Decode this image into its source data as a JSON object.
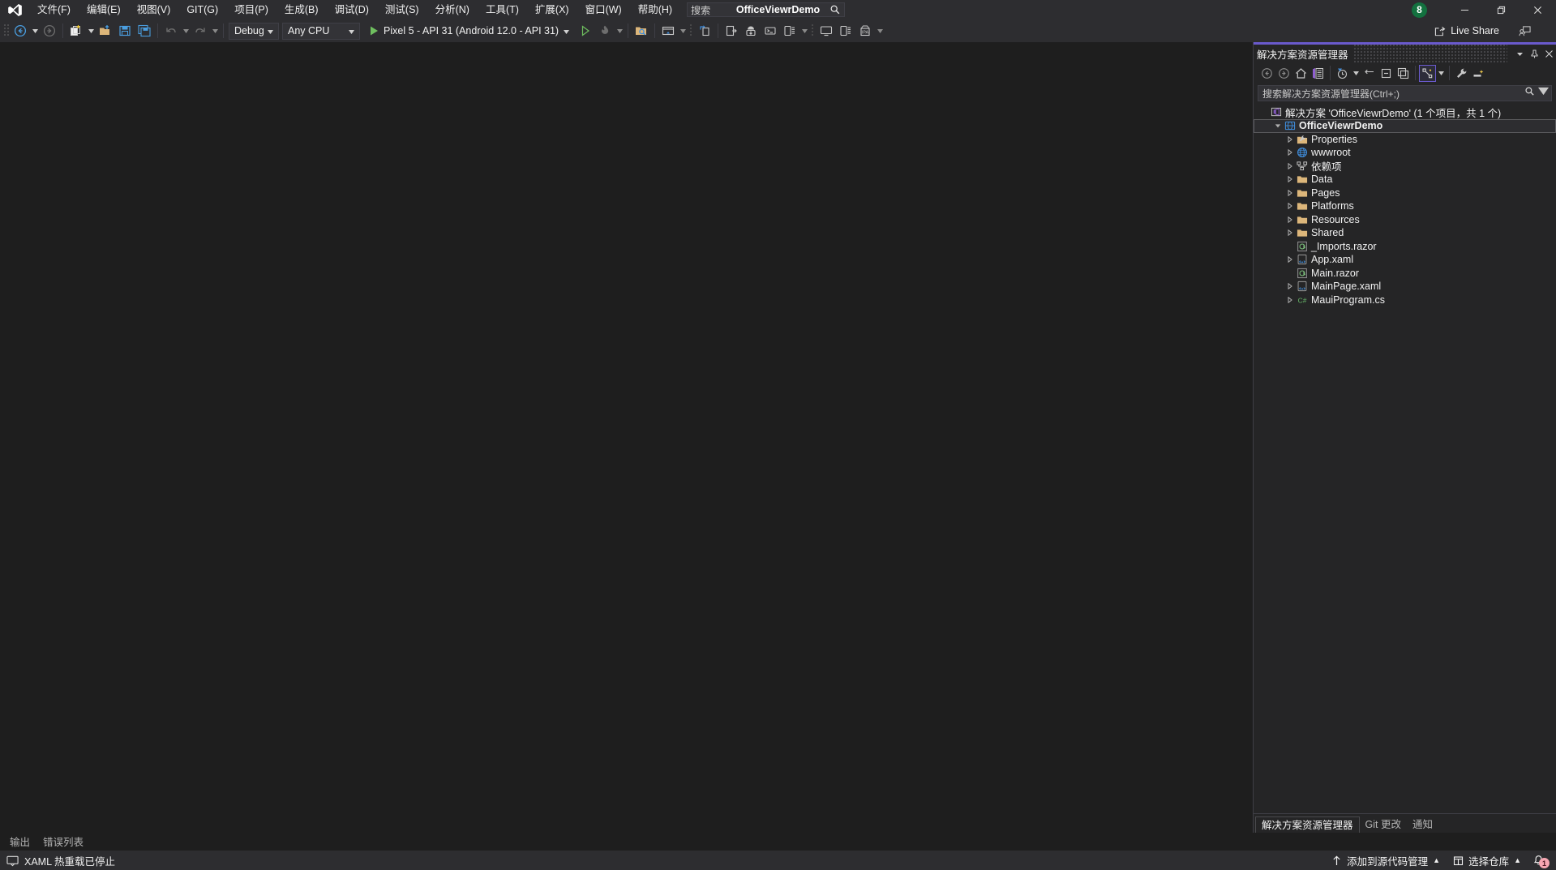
{
  "window": {
    "title": "OfficeViewrDemo",
    "account_badge": "8",
    "minimize_icon": "minimize-icon",
    "restore_icon": "restore-icon",
    "close_icon": "close-icon"
  },
  "menu": {
    "logo_icon": "visual-studio-logo-icon",
    "items": [
      {
        "text": "文件(F)",
        "accel": "F"
      },
      {
        "text": "编辑(E)",
        "accel": "E"
      },
      {
        "text": "视图(V)",
        "accel": "V"
      },
      {
        "text": "GIT(G)",
        "accel": "G"
      },
      {
        "text": "项目(P)",
        "accel": "P"
      },
      {
        "text": "生成(B)",
        "accel": "B"
      },
      {
        "text": "调试(D)",
        "accel": "D"
      },
      {
        "text": "测试(S)",
        "accel": "S"
      },
      {
        "text": "分析(N)",
        "accel": "N"
      },
      {
        "text": "工具(T)",
        "accel": "T"
      },
      {
        "text": "扩展(X)",
        "accel": "X"
      },
      {
        "text": "窗口(W)",
        "accel": "W"
      },
      {
        "text": "帮助(H)",
        "accel": "H"
      }
    ],
    "search_placeholder": "搜索",
    "search_icon": "search-icon"
  },
  "toolbar": {
    "navigate_back_icon": "navigate-back-icon",
    "navigate_forward_icon": "navigate-forward-icon",
    "new_project_icon": "new-project-icon",
    "open_file_icon": "open-file-icon",
    "save_icon": "save-icon",
    "save_all_icon": "save-all-icon",
    "undo_icon": "undo-icon",
    "redo_icon": "redo-icon",
    "configuration": "Debug",
    "platform": "Any CPU",
    "run_target": "Pixel 5 - API 31 (Android 12.0 - API 31)",
    "run_icon": "run-play-icon",
    "attach_icon": "attach-play-icon",
    "hot_reload_icon": "hot-reload-flame-icon",
    "solution_explorer_search_icon": "search-solution-icon",
    "toolbox_icon": "toolbox-icon",
    "refresh_icon": "refresh-window-icon",
    "device_icons": [
      "deploy-device-icon",
      "android-device-manager-icon",
      "android-adb-terminal-icon",
      "device-log-icon",
      "monitor-icon",
      "device-preview-icon",
      "ipa-package-icon"
    ],
    "live_share_label": "Live Share",
    "live_share_icon": "live-share-icon",
    "feedback_icon": "send-feedback-icon"
  },
  "solution_explorer": {
    "title": "解决方案资源管理器",
    "window_menu_icon": "chevron-down-icon",
    "pin_icon": "pin-icon",
    "close_icon": "close-icon",
    "tools": [
      {
        "name": "back-icon"
      },
      {
        "name": "forward-icon"
      },
      {
        "name": "home-icon"
      },
      {
        "name": "solution-explorer-icon"
      },
      {
        "name": "pending-changes-filter-icon"
      },
      {
        "name": "sync-with-active-document-icon"
      },
      {
        "name": "collapse-all-icon"
      },
      {
        "name": "show-all-files-icon"
      },
      {
        "name": "view-selector-icon"
      },
      {
        "name": "properties-wrench-icon"
      },
      {
        "name": "preview-selected-items-icon"
      }
    ],
    "search_placeholder": "搜索解决方案资源管理器(Ctrl+;)",
    "search_icon": "search-icon",
    "tree": [
      {
        "label": "解决方案 'OfficeViewrDemo' (1 个项目，共 1 个)",
        "icon": "solution-icon",
        "indent": 0,
        "expander": "none",
        "selected": false,
        "bold": false
      },
      {
        "label": "OfficeViewrDemo",
        "icon": "blazor-project-icon",
        "indent": 1,
        "expander": "expanded",
        "selected": true,
        "bold": true
      },
      {
        "label": "Properties",
        "icon": "properties-folder-icon",
        "indent": 2,
        "expander": "collapsed",
        "selected": false,
        "bold": false
      },
      {
        "label": "wwwroot",
        "icon": "wwwroot-globe-icon",
        "indent": 2,
        "expander": "collapsed",
        "selected": false,
        "bold": false
      },
      {
        "label": "依赖项",
        "icon": "dependencies-icon",
        "indent": 2,
        "expander": "collapsed",
        "selected": false,
        "bold": false
      },
      {
        "label": "Data",
        "icon": "folder-icon",
        "indent": 2,
        "expander": "collapsed",
        "selected": false,
        "bold": false
      },
      {
        "label": "Pages",
        "icon": "folder-icon",
        "indent": 2,
        "expander": "collapsed",
        "selected": false,
        "bold": false
      },
      {
        "label": "Platforms",
        "icon": "folder-icon",
        "indent": 2,
        "expander": "collapsed",
        "selected": false,
        "bold": false
      },
      {
        "label": "Resources",
        "icon": "folder-icon",
        "indent": 2,
        "expander": "collapsed",
        "selected": false,
        "bold": false
      },
      {
        "label": "Shared",
        "icon": "folder-icon",
        "indent": 2,
        "expander": "collapsed",
        "selected": false,
        "bold": false
      },
      {
        "label": "_Imports.razor",
        "icon": "razor-file-icon",
        "indent": 2,
        "expander": "none",
        "selected": false,
        "bold": false
      },
      {
        "label": "App.xaml",
        "icon": "xaml-file-icon",
        "indent": 2,
        "expander": "collapsed",
        "selected": false,
        "bold": false
      },
      {
        "label": "Main.razor",
        "icon": "razor-file-icon",
        "indent": 2,
        "expander": "none",
        "selected": false,
        "bold": false
      },
      {
        "label": "MainPage.xaml",
        "icon": "xaml-file-icon",
        "indent": 2,
        "expander": "collapsed",
        "selected": false,
        "bold": false
      },
      {
        "label": "MauiProgram.cs",
        "icon": "csharp-file-icon",
        "indent": 2,
        "expander": "collapsed",
        "selected": false,
        "bold": false
      }
    ],
    "tabs": [
      {
        "label": "解决方案资源管理器",
        "active": true
      },
      {
        "label": "Git 更改",
        "active": false
      },
      {
        "label": "通知",
        "active": false
      }
    ]
  },
  "bottom_tabs": [
    {
      "label": "输出"
    },
    {
      "label": "错误列表"
    }
  ],
  "status_bar": {
    "hot_reload_icon": "xaml-hot-reload-icon",
    "hot_reload_text": "XAML 热重载已停止",
    "source_control_icon": "up-arrow-icon",
    "source_control_label": "添加到源代码管理",
    "repo_icon": "repository-icon",
    "repo_label": "选择仓库",
    "notification_icon": "bell-icon",
    "notification_count": "1"
  },
  "colors": {
    "accent_purple": "#6a5acd",
    "titlebar_bg": "#2d2d30",
    "editor_bg": "#1e1e1e",
    "panel_bg": "#252526",
    "account_green": "#13713f",
    "badge_pink": "#f6a6b2",
    "play_green": "#6fbf5f",
    "folder_yellow": "#dcb67a",
    "globe_blue": "#3f8ddc",
    "csharp_green": "#68b96a"
  }
}
